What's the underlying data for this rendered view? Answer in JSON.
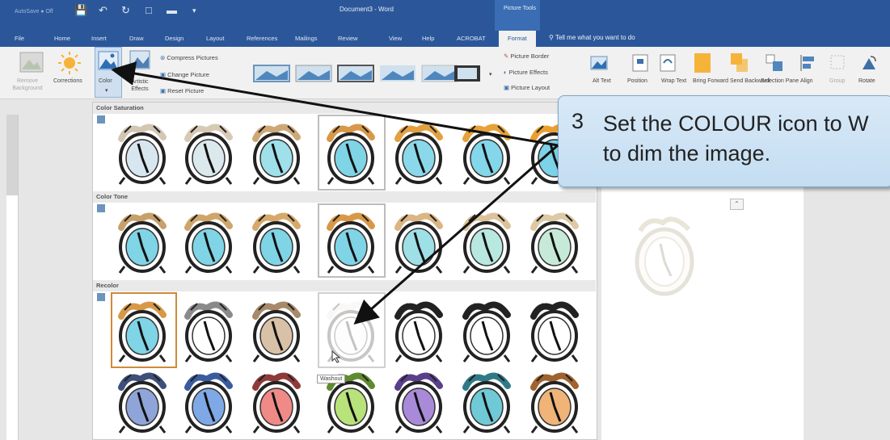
{
  "titlebar": {
    "autosave": "AutoSave ● Off",
    "document_title": "Document3  -  Word",
    "context_group": "Picture Tools"
  },
  "tabs": [
    "File",
    "Home",
    "Insert",
    "Draw",
    "Design",
    "Layout",
    "References",
    "Mailings",
    "Review",
    "View",
    "Help",
    "ACROBAT",
    "Format"
  ],
  "tell_me": "Tell me what you want to do",
  "ribbon": {
    "remove_background": "Remove Background",
    "corrections": "Corrections",
    "color": "Color",
    "artistic_effects": "Artistic Effects",
    "compress_pictures": "Compress Pictures",
    "change_picture": "Change Picture",
    "reset_picture": "Reset Picture",
    "picture_border": "Picture Border",
    "picture_effects": "Picture Effects",
    "picture_layout": "Picture Layout",
    "alt_text": "Alt Text",
    "position": "Position",
    "wrap_text": "Wrap Text",
    "bring_forward": "Bring Forward",
    "send_backward": "Send Backward",
    "selection_pane": "Selection Pane",
    "align": "Align",
    "group": "Group",
    "rotate": "Rotate"
  },
  "gallery": {
    "color_saturation": "Color Saturation",
    "color_tone": "Color Tone",
    "recolor": "Recolor",
    "tooltip": "Washout"
  },
  "callout": {
    "number": "3",
    "line1": "Set the COLOUR icon to W",
    "line2": "to dim the image."
  },
  "colors": {
    "word_blue": "#2b579a",
    "callout_fill": "#cfe3f5",
    "clock_teal": "#7fd4e6"
  }
}
